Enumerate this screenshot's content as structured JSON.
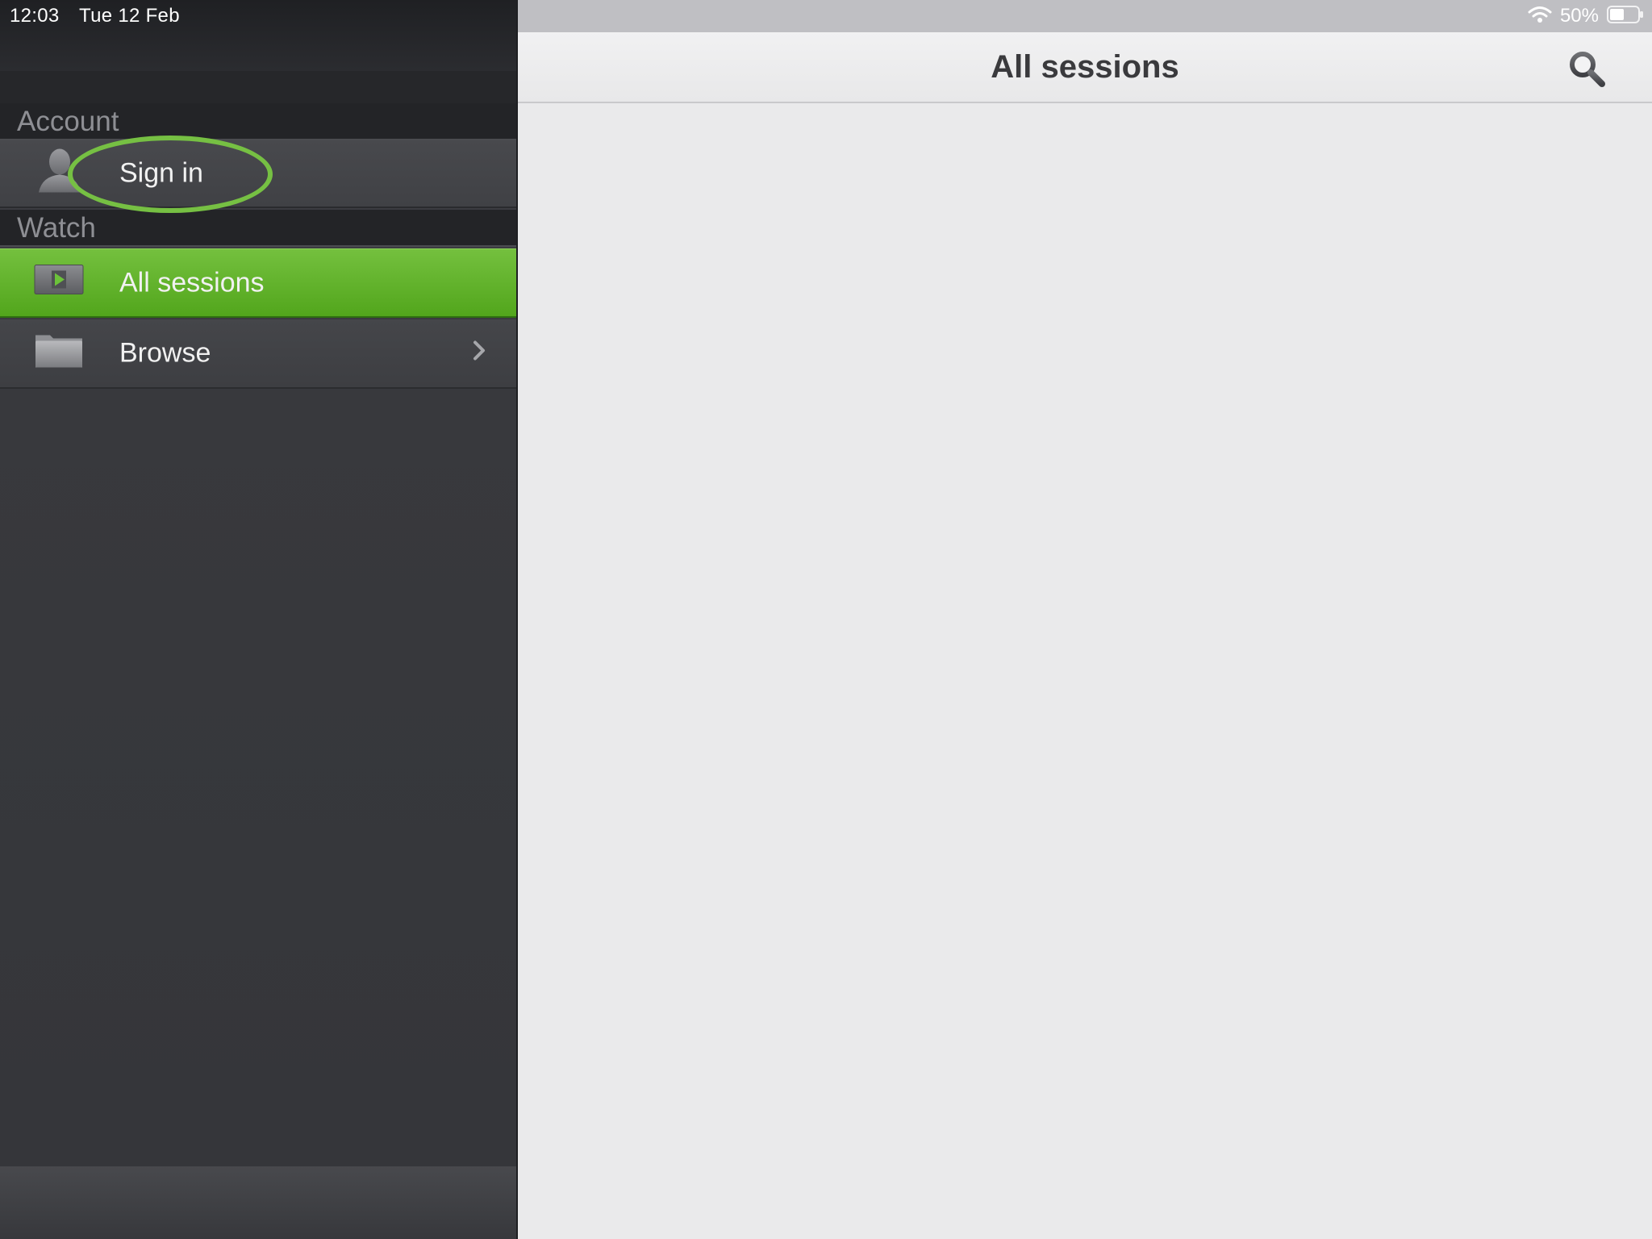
{
  "status_bar": {
    "time": "12:03",
    "date": "Tue 12 Feb",
    "battery": "50%",
    "icons": [
      "wifi-icon",
      "battery-icon"
    ]
  },
  "sidebar": {
    "sections": [
      {
        "header": "Account",
        "items": [
          {
            "label": "Sign in",
            "icon": "person-icon",
            "highlighted": true
          }
        ]
      },
      {
        "header": "Watch",
        "items": [
          {
            "label": "All sessions",
            "icon": "play-icon",
            "selected": true
          },
          {
            "label": "Browse",
            "icon": "folder-icon",
            "has_chevron": true
          }
        ]
      }
    ]
  },
  "main": {
    "title": "All sessions",
    "search_icon": "search-icon"
  },
  "colors": {
    "accent": "#5aae24",
    "highlight_ring": "#76c043",
    "sidebar_bg": "#3a3b3f",
    "main_bg": "#eaeaeb"
  }
}
